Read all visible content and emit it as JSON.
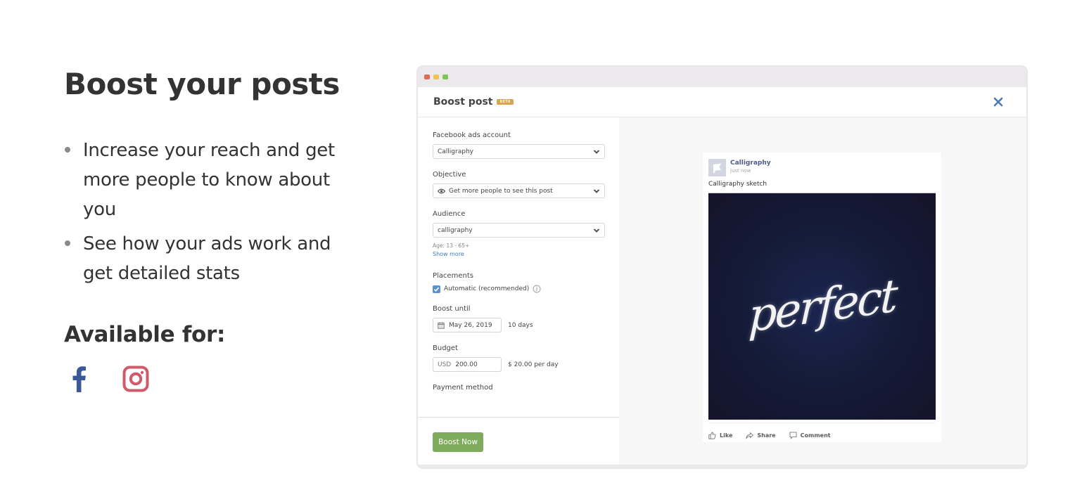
{
  "promo": {
    "title": "Boost your posts",
    "bullets": [
      "Increase your reach and get more people to know about you",
      "See how your ads work and get detailed stats"
    ],
    "available_label": "Available for:",
    "platforms": [
      {
        "name": "facebook-icon",
        "color": "#3b5998"
      },
      {
        "name": "instagram-icon",
        "color": "#d05a6a"
      }
    ]
  },
  "window": {
    "controls": {
      "close": "#e06b55",
      "minimize": "#f0c24f",
      "maximize": "#7cc552"
    }
  },
  "modal": {
    "title": "Boost post",
    "badge": "BETA",
    "close_icon": "close-icon",
    "accent": "#7fab5d",
    "fields": {
      "ads_account": {
        "label": "Facebook ads account",
        "value": "Calligraphy"
      },
      "objective": {
        "label": "Objective",
        "value": "Get more people to see this post"
      },
      "audience": {
        "label": "Audience",
        "value": "calligraphy",
        "hint": "Age: 13 - 65+",
        "show_more": "Show more"
      },
      "placements": {
        "label": "Placements",
        "option": "Automatic (recommended)",
        "checked": true
      },
      "boost_until": {
        "label": "Boost until",
        "value": "May 26, 2019",
        "duration": "10 days"
      },
      "budget": {
        "label": "Budget",
        "currency": "USD",
        "value": "200.00",
        "per_day": "$ 20.00 per day"
      },
      "payment": {
        "label": "Payment method"
      }
    },
    "submit_label": "Boost Now"
  },
  "preview": {
    "page_name": "Calligraphy",
    "time": "just now",
    "text": "Calligraphy sketch",
    "image_text": "perfect",
    "actions": [
      "Like",
      "Share",
      "Comment"
    ]
  }
}
